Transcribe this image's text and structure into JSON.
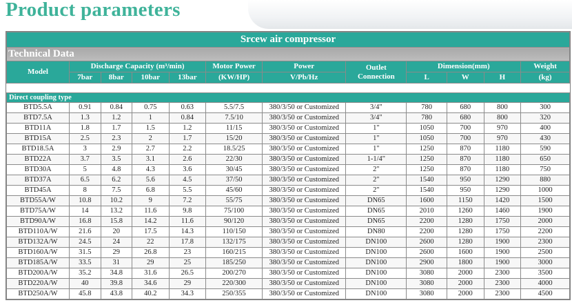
{
  "page": {
    "title": "Product parameters"
  },
  "table": {
    "banner": "Srcew air compressor",
    "technical_label": "Technical Data",
    "headers": {
      "model": "Model",
      "discharge": "Discharge Capacity (m³/min)",
      "pressures": [
        "7bar",
        "8bar",
        "10bar",
        "13bar"
      ],
      "motor_power": "Motor Power",
      "motor_power_unit": "(KW/HP)",
      "power": "Power",
      "power_unit": "V/Pb/Hz",
      "outlet": "Outlet",
      "outlet_sub": "Connection",
      "dimension": "Dimension(mm)",
      "dims": [
        "L",
        "W",
        "H"
      ],
      "weight": "Weight",
      "weight_unit": "(kg)"
    },
    "section_label": "Direct coupling type",
    "rows": [
      [
        "BTD5.5A",
        "0.91",
        "0.84",
        "0.75",
        "0.63",
        "5.5/7.5",
        "380/3/50 or Customized",
        "3/4\"",
        "780",
        "680",
        "800",
        "300"
      ],
      [
        "BTD7.5A",
        "1.3",
        "1.2",
        "1",
        "0.84",
        "7.5/10",
        "380/3/50 or Customized",
        "3/4\"",
        "780",
        "680",
        "800",
        "320"
      ],
      [
        "BTD11A",
        "1.8",
        "1.7",
        "1.5",
        "1.2",
        "11/15",
        "380/3/50 or Customized",
        "1\"",
        "1050",
        "700",
        "970",
        "400"
      ],
      [
        "BTD15A",
        "2.5",
        "2.3",
        "2",
        "1.7",
        "15/20",
        "380/3/50 or Customized",
        "1\"",
        "1050",
        "700",
        "970",
        "430"
      ],
      [
        "BTD18.5A",
        "3",
        "2.9",
        "2.7",
        "2.2",
        "18.5/25",
        "380/3/50 or Customized",
        "1\"",
        "1250",
        "870",
        "1180",
        "590"
      ],
      [
        "BTD22A",
        "3.7",
        "3.5",
        "3.1",
        "2.6",
        "22/30",
        "380/3/50 or Customized",
        "1-1/4\"",
        "1250",
        "870",
        "1180",
        "650"
      ],
      [
        "BTD30A",
        "5",
        "4.8",
        "4.3",
        "3.6",
        "30/45",
        "380/3/50 or Customized",
        "2\"",
        "1250",
        "870",
        "1180",
        "750"
      ],
      [
        "BTD37A",
        "6.5",
        "6.2",
        "5.6",
        "4.5",
        "37/50",
        "380/3/50 or Customized",
        "2\"",
        "1540",
        "950",
        "1290",
        "880"
      ],
      [
        "BTD45A",
        "8",
        "7.5",
        "6.8",
        "5.5",
        "45/60",
        "380/3/50 or Customized",
        "2\"",
        "1540",
        "950",
        "1290",
        "1000"
      ],
      [
        "BTD55A/W",
        "10.8",
        "10.2",
        "9",
        "7.2",
        "55/75",
        "380/3/50 or Customized",
        "DN65",
        "1600",
        "1150",
        "1420",
        "1500"
      ],
      [
        "BTD75A/W",
        "14",
        "13.2",
        "11.6",
        "9.8",
        "75/100",
        "380/3/50 or Customized",
        "DN65",
        "2010",
        "1260",
        "1460",
        "1900"
      ],
      [
        "BTD90A/W",
        "16.8",
        "15.8",
        "14.2",
        "11.6",
        "90/120",
        "380/3/50 or Customized",
        "DN65",
        "2200",
        "1280",
        "1750",
        "2000"
      ],
      [
        "BTD110A/W",
        "21.6",
        "20",
        "17.5",
        "14.3",
        "110/150",
        "380/3/50 or Customized",
        "DN80",
        "2200",
        "1280",
        "1750",
        "2200"
      ],
      [
        "BTD132A/W",
        "24.5",
        "24",
        "22",
        "17.8",
        "132/175",
        "380/3/50 or Customized",
        "DN100",
        "2600",
        "1280",
        "1900",
        "2300"
      ],
      [
        "BTD160A/W",
        "31.5",
        "29",
        "26.8",
        "23",
        "160/215",
        "380/3/50 or Customized",
        "DN100",
        "2600",
        "1600",
        "1900",
        "2500"
      ],
      [
        "BTD185A/W",
        "33.5",
        "31",
        "29",
        "25",
        "185/250",
        "380/3/50 or Customized",
        "DN100",
        "2900",
        "1800",
        "1900",
        "3000"
      ],
      [
        "BTD200A/W",
        "35.2",
        "34.8",
        "31.6",
        "26.5",
        "200/270",
        "380/3/50 or Customized",
        "DN100",
        "3080",
        "2000",
        "2300",
        "3500"
      ],
      [
        "BTD220A/W",
        "40",
        "39.8",
        "34.6",
        "29",
        "220/300",
        "380/3/50 or Customized",
        "DN100",
        "3080",
        "2000",
        "2300",
        "4000"
      ],
      [
        "BTD250A/W",
        "45.8",
        "43.8",
        "40.2",
        "34.3",
        "250/355",
        "380/3/50 or Customized",
        "DN100",
        "3080",
        "2000",
        "2300",
        "4500"
      ]
    ]
  },
  "colors": {
    "title": "#3fb39a",
    "header_bg": "#2aa89a",
    "tech_bg": "#b3b3b3"
  }
}
